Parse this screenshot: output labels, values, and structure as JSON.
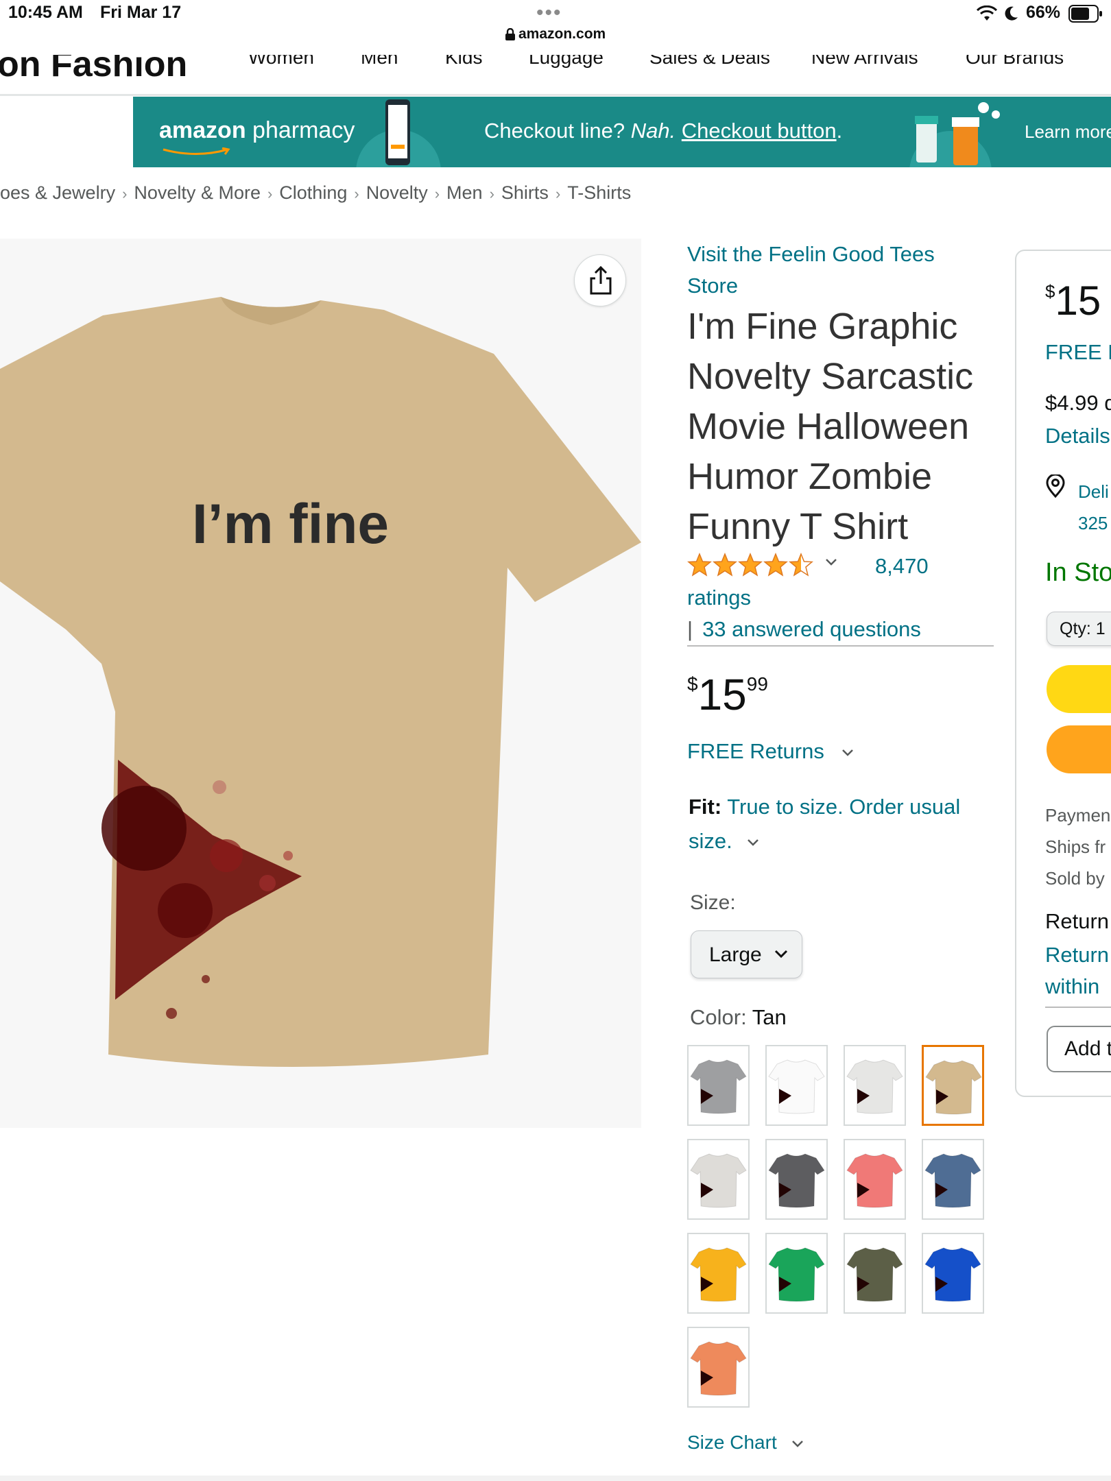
{
  "status_bar": {
    "time": "10:45 AM",
    "date": "Fri Mar 17",
    "dots": "•••",
    "url": "amazon.com",
    "battery": "66%"
  },
  "top_nav": {
    "brand": "on Fashion",
    "items": [
      "Women",
      "Men",
      "Kids",
      "Luggage",
      "Sales & Deals",
      "New Arrivals",
      "Our Brands"
    ]
  },
  "banner": {
    "logo_bold": "amazon",
    "logo_rest": " pharmacy",
    "msg_a": "Checkout line? ",
    "msg_b": "Nah.",
    "msg_c": " ",
    "msg_d": "Checkout button",
    "msg_e": ".",
    "learn": "Learn more",
    "bg_color": "#1a8a87"
  },
  "breadcrumb": [
    "oes & Jewelry",
    "Novelty & More",
    "Clothing",
    "Novelty",
    "Men",
    "Shirts",
    "T-Shirts"
  ],
  "product": {
    "shirt_text": "I’m fine",
    "shirt_color": "#d3b98e",
    "store_link": "Visit the Feelin Good Tees Store",
    "title": "I'm Fine Graphic Novelty Sarcastic Movie Halloween Humor Zombie Funny T Shirt",
    "rating": 4.5,
    "ratings_count": "8,470",
    "ratings_word": "ratings",
    "qa_bar": "|",
    "answered_questions": "33 answered questions",
    "price": {
      "symbol": "$",
      "whole": "15",
      "fraction": "99"
    },
    "free_returns": "FREE Returns",
    "fit_label": "Fit:",
    "fit_value": "True to size. Order usual size.",
    "size_label": "Size:",
    "size_value": "Large",
    "color_label": "Color: ",
    "color_value": "Tan",
    "swatches": [
      {
        "color": "#9e9fa1",
        "selected": false
      },
      {
        "color": "#fafafa",
        "selected": false
      },
      {
        "color": "#e6e6e4",
        "selected": false
      },
      {
        "color": "#d3b98e",
        "selected": true
      },
      {
        "color": "#dedcd8",
        "selected": false
      },
      {
        "color": "#5d5d60",
        "selected": false
      },
      {
        "color": "#f07977",
        "selected": false
      },
      {
        "color": "#4f6d94",
        "selected": false
      },
      {
        "color": "#f7b21c",
        "selected": false
      },
      {
        "color": "#1aa55a",
        "selected": false
      },
      {
        "color": "#5c5f47",
        "selected": false
      },
      {
        "color": "#1550c9",
        "selected": false
      },
      {
        "color": "#ee8a5c",
        "selected": false
      }
    ],
    "size_chart": "Size Chart"
  },
  "buy_box": {
    "price_symbol": "$",
    "price_whole": "15",
    "free": "FREE R",
    "fee": "$4.99 d",
    "details": "Details",
    "deliver_line1": "Deli",
    "deliver_line2": "325",
    "stock": "In Sto",
    "qty": "Qty: 1",
    "payment": "Paymen",
    "ships": "Ships fr",
    "sold": "Sold by",
    "return_head": "Return",
    "return_line1": "Return",
    "return_line2": "within",
    "add": "Add t",
    "cart_color": "#ffd814",
    "buy_color": "#ffa41c"
  },
  "colors": {
    "link": "#007185",
    "star": "#ffa41c",
    "stock": "#007600",
    "selected_border": "#e77600"
  }
}
